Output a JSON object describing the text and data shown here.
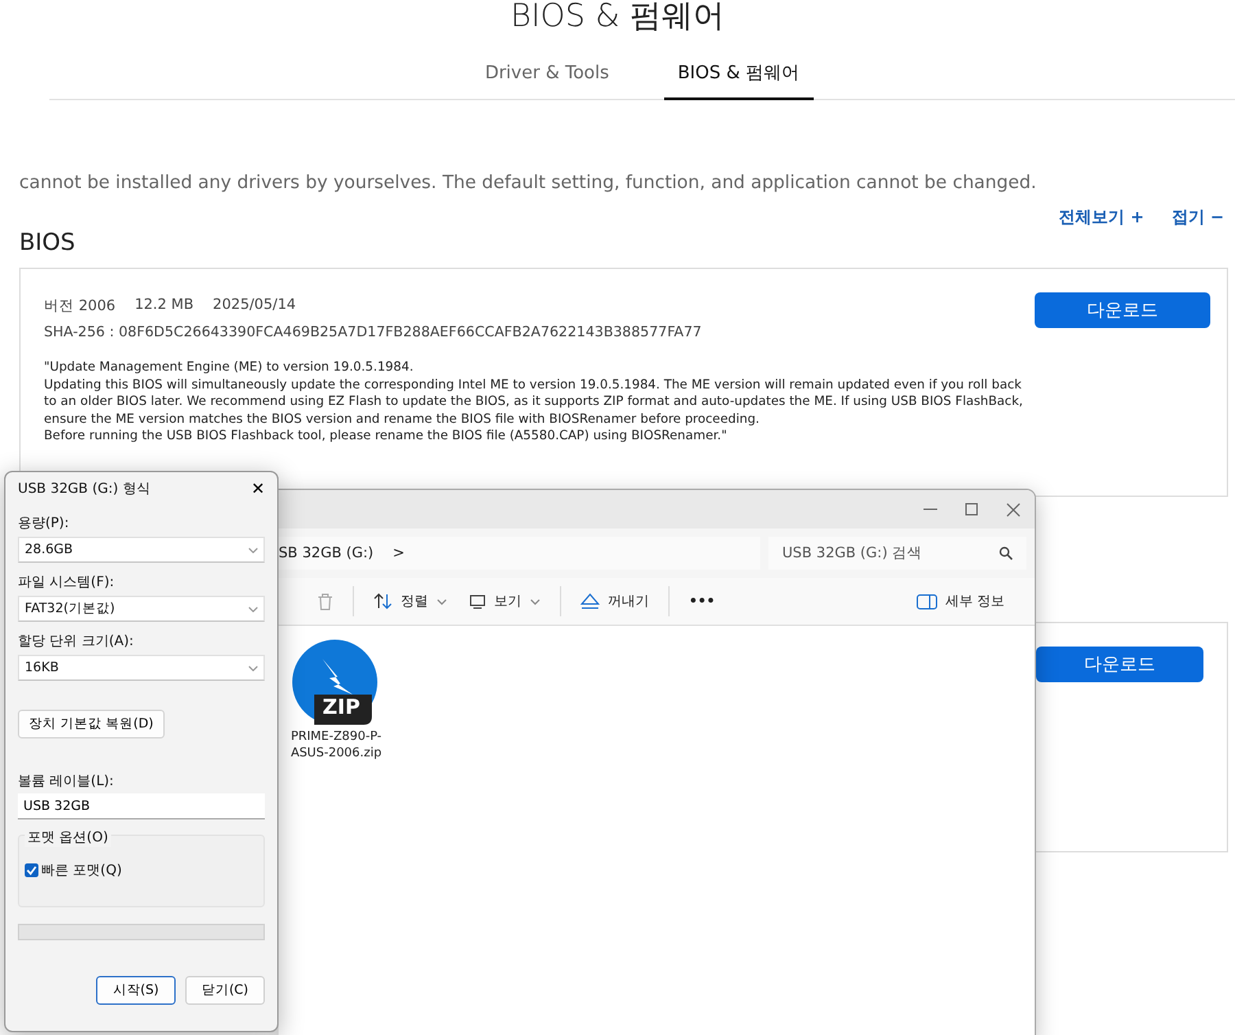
{
  "page": {
    "title": "BIOS & 펌웨어",
    "tabs": [
      {
        "label": "Driver & Tools",
        "selected": false
      },
      {
        "label": "BIOS & 펌웨어",
        "selected": true
      }
    ],
    "notice": "cannot be installed any drivers by yourselves. The default setting, function, and application cannot be changed.",
    "links": [
      "전체보기 +",
      "접기 −"
    ],
    "section_title": "BIOS",
    "cards": [
      {
        "version_label": "버전",
        "version": "2006",
        "size": "12.2 MB",
        "date": "2025/05/14",
        "sha_label": "SHA-256",
        "sha": ": 08F6D5C26643390FCA469B25A7D17FB288AEF66CCAFB2A7622143B388577FA77",
        "description": [
          "\"Update Management Engine (ME) to version 19.0.5.1984.",
          "Updating this BIOS will simultaneously update the corresponding Intel ME to version 19.0.5.1984. The ME version will remain updated even if you roll back to an older BIOS later. We recommend using EZ Flash to update the BIOS, as it supports ZIP format and auto-updates the ME. If using USB BIOS FlashBack, ensure the ME version matches the BIOS version and rename the BIOS file with BIOSRenamer before proceeding.",
          "Before running the USB BIOS Flashback tool, please rename the BIOS file (A5580.CAP) using BIOSRenamer.\""
        ],
        "download": "다운로드"
      },
      {
        "download": "다운로드"
      }
    ]
  },
  "explorer": {
    "address": "SB 32GB (G:)",
    "address_arrow": ">",
    "search": {
      "placeholder": "USB 32GB (G:) 검색"
    },
    "toolbar": [
      {
        "kind": "delete"
      },
      {
        "kind": "sort",
        "label": "정렬"
      },
      {
        "kind": "view",
        "label": "보기"
      },
      {
        "kind": "eject",
        "label": "꺼내기"
      },
      {
        "kind": "more",
        "label": "•••"
      }
    ],
    "details": "세부 정보",
    "files": [
      {
        "kind": "zip",
        "badge": "ZIP",
        "name": "PRIME-Z890-P-ASUS-2006.zip"
      }
    ]
  },
  "format_dialog": {
    "title": "USB 32GB (G:) 형식",
    "close": "✕",
    "fields": [
      {
        "label": "용량(P):",
        "value": "28.6GB"
      },
      {
        "label": "파일 시스템(F):",
        "value": "FAT32(기본값)"
      },
      {
        "label": "할당 단위 크기(A):",
        "value": "16KB"
      }
    ],
    "restore_button": "장치 기본값 복원(D)",
    "volume_label": {
      "label": "볼륨 레이블(L):",
      "value": "USB 32GB"
    },
    "options_group": "포맷 옵션(O)",
    "quick_format": {
      "label": "빠른 포맷(Q)",
      "checked": true
    },
    "progress": {
      "level": 0
    },
    "buttons": [
      {
        "label": "시작(S)",
        "default": true
      },
      {
        "label": "닫기(C)",
        "default": false
      }
    ]
  }
}
